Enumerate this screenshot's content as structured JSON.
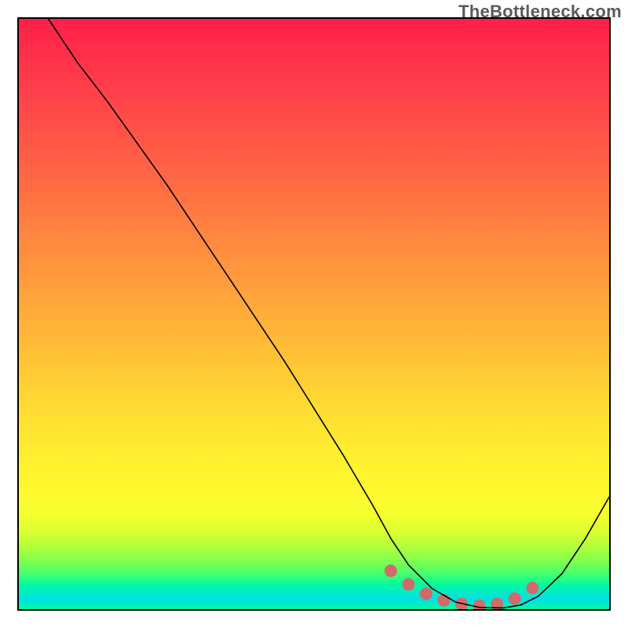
{
  "watermark": "TheBottleneck.com",
  "chart_data": {
    "type": "line",
    "title": "",
    "xlabel": "",
    "ylabel": "",
    "xlim": [
      0,
      100
    ],
    "ylim": [
      0,
      100
    ],
    "grid": false,
    "legend": false,
    "series": [
      {
        "name": "bottleneck-curve",
        "color": "#000000",
        "stroke_width": 1.6,
        "x": [
          5,
          10,
          15,
          20,
          25,
          30,
          35,
          40,
          45,
          50,
          55,
          60,
          63,
          66,
          70,
          74,
          78,
          82,
          85,
          88,
          92,
          96,
          100
        ],
        "y": [
          100,
          92.5,
          86,
          79,
          72,
          64.5,
          57,
          49.5,
          42,
          34,
          26,
          17.5,
          12,
          7.5,
          3.5,
          1.2,
          0.3,
          0.2,
          0.7,
          2.2,
          6,
          12,
          19
        ]
      },
      {
        "name": "optimal-band-dots",
        "color": "#d26a6a",
        "marker_radius": 8,
        "x": [
          63,
          66,
          69,
          72,
          75,
          78,
          81,
          84,
          87
        ],
        "y": [
          6.5,
          4.2,
          2.6,
          1.5,
          0.9,
          0.6,
          0.9,
          1.8,
          3.6
        ]
      }
    ],
    "background_gradient": {
      "type": "vertical",
      "stops": [
        {
          "pos": 0.0,
          "color": "#ff1f4a"
        },
        {
          "pos": 0.25,
          "color": "#ff6245"
        },
        {
          "pos": 0.5,
          "color": "#ffb238"
        },
        {
          "pos": 0.75,
          "color": "#fff92e"
        },
        {
          "pos": 0.9,
          "color": "#b0ff3a"
        },
        {
          "pos": 0.96,
          "color": "#00f7a6"
        },
        {
          "pos": 1.0,
          "color": "#00ff88"
        }
      ]
    }
  }
}
